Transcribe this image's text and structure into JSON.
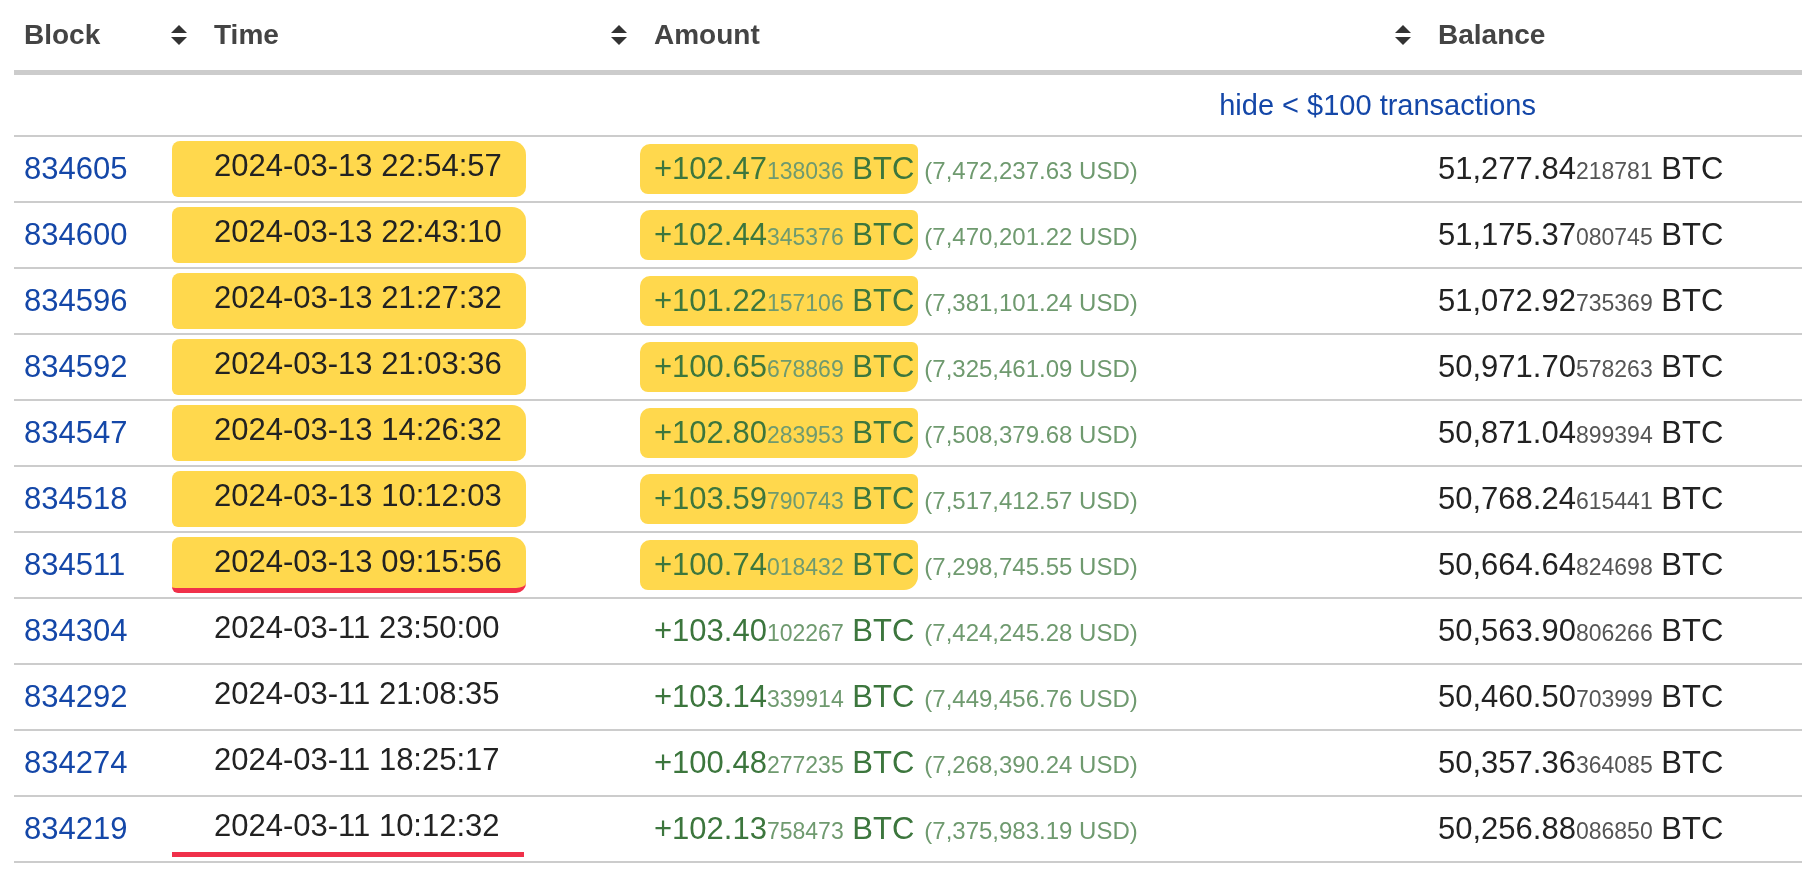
{
  "columns": [
    {
      "label": "Block",
      "sortable": true
    },
    {
      "label": "Time",
      "sortable": true
    },
    {
      "label": "Amount",
      "sortable": true
    },
    {
      "label": "Balance",
      "sortable": false
    }
  ],
  "filter_link": "hide < $100 transactions",
  "rows": [
    {
      "block": "834605",
      "time": "2024-03-13 22:54:57",
      "time_highlight": true,
      "underline": false,
      "amount": {
        "main": "+102.47",
        "minor": "138036",
        "unit": "BTC"
      },
      "amount_highlight": true,
      "usd": "(7,472,237.63 USD)",
      "balance": {
        "main": "51,277.84",
        "minor": "218781",
        "unit": "BTC"
      }
    },
    {
      "block": "834600",
      "time": "2024-03-13 22:43:10",
      "time_highlight": true,
      "underline": false,
      "amount": {
        "main": "+102.44",
        "minor": "345376",
        "unit": "BTC"
      },
      "amount_highlight": true,
      "usd": "(7,470,201.22 USD)",
      "balance": {
        "main": "51,175.37",
        "minor": "080745",
        "unit": "BTC"
      }
    },
    {
      "block": "834596",
      "time": "2024-03-13 21:27:32",
      "time_highlight": true,
      "underline": false,
      "amount": {
        "main": "+101.22",
        "minor": "157106",
        "unit": "BTC"
      },
      "amount_highlight": true,
      "usd": "(7,381,101.24 USD)",
      "balance": {
        "main": "51,072.92",
        "minor": "735369",
        "unit": "BTC"
      }
    },
    {
      "block": "834592",
      "time": "2024-03-13 21:03:36",
      "time_highlight": true,
      "underline": false,
      "amount": {
        "main": "+100.65",
        "minor": "678869",
        "unit": "BTC"
      },
      "amount_highlight": true,
      "usd": "(7,325,461.09 USD)",
      "balance": {
        "main": "50,971.70",
        "minor": "578263",
        "unit": "BTC"
      }
    },
    {
      "block": "834547",
      "time": "2024-03-13 14:26:32",
      "time_highlight": true,
      "underline": false,
      "amount": {
        "main": "+102.80",
        "minor": "283953",
        "unit": "BTC"
      },
      "amount_highlight": true,
      "usd": "(7,508,379.68 USD)",
      "balance": {
        "main": "50,871.04",
        "minor": "899394",
        "unit": "BTC"
      }
    },
    {
      "block": "834518",
      "time": "2024-03-13 10:12:03",
      "time_highlight": true,
      "underline": false,
      "amount": {
        "main": "+103.59",
        "minor": "790743",
        "unit": "BTC"
      },
      "amount_highlight": true,
      "usd": "(7,517,412.57 USD)",
      "balance": {
        "main": "50,768.24",
        "minor": "615441",
        "unit": "BTC"
      }
    },
    {
      "block": "834511",
      "time": "2024-03-13 09:15:56",
      "time_highlight": true,
      "underline": true,
      "amount": {
        "main": "+100.74",
        "minor": "018432",
        "unit": "BTC"
      },
      "amount_highlight": true,
      "usd": "(7,298,745.55 USD)",
      "balance": {
        "main": "50,664.64",
        "minor": "824698",
        "unit": "BTC"
      }
    },
    {
      "block": "834304",
      "time": "2024-03-11 23:50:00",
      "time_highlight": false,
      "underline": false,
      "amount": {
        "main": "+103.40",
        "minor": "102267",
        "unit": "BTC"
      },
      "amount_highlight": false,
      "usd": "(7,424,245.28 USD)",
      "balance": {
        "main": "50,563.90",
        "minor": "806266",
        "unit": "BTC"
      }
    },
    {
      "block": "834292",
      "time": "2024-03-11 21:08:35",
      "time_highlight": false,
      "underline": false,
      "amount": {
        "main": "+103.14",
        "minor": "339914",
        "unit": "BTC"
      },
      "amount_highlight": false,
      "usd": "(7,449,456.76 USD)",
      "balance": {
        "main": "50,460.50",
        "minor": "703999",
        "unit": "BTC"
      }
    },
    {
      "block": "834274",
      "time": "2024-03-11 18:25:17",
      "time_highlight": false,
      "underline": false,
      "amount": {
        "main": "+100.48",
        "minor": "277235",
        "unit": "BTC"
      },
      "amount_highlight": false,
      "usd": "(7,268,390.24 USD)",
      "balance": {
        "main": "50,357.36",
        "minor": "364085",
        "unit": "BTC"
      }
    },
    {
      "block": "834219",
      "time": "2024-03-11 10:12:32",
      "time_highlight": false,
      "underline": true,
      "amount": {
        "main": "+102.13",
        "minor": "758473",
        "unit": "BTC"
      },
      "amount_highlight": false,
      "usd": "(7,375,983.19 USD)",
      "balance": {
        "main": "50,256.88",
        "minor": "086850",
        "unit": "BTC"
      }
    }
  ]
}
